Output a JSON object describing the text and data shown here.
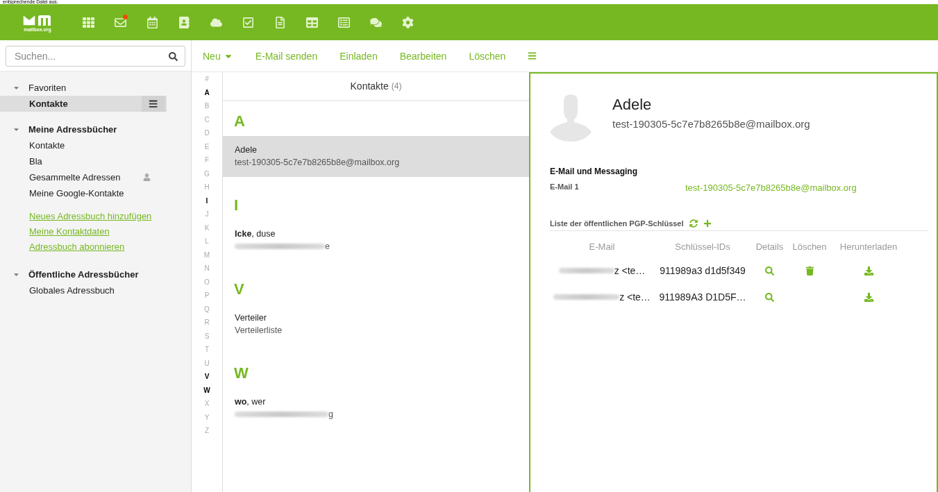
{
  "caption": "entsprechende Datei aus.",
  "app_bar": {
    "logo_text": "mailbox.org",
    "apps": [
      {
        "kind": "grid",
        "badge": false
      },
      {
        "kind": "mail",
        "badge": true
      },
      {
        "kind": "calendar",
        "badge": false
      },
      {
        "kind": "contacts",
        "badge": false
      },
      {
        "kind": "cloud",
        "badge": false
      },
      {
        "kind": "tasks",
        "badge": false
      },
      {
        "kind": "document",
        "badge": false
      },
      {
        "kind": "spreadsheet",
        "badge": false
      },
      {
        "kind": "presentation",
        "badge": false
      },
      {
        "kind": "chat",
        "badge": false
      },
      {
        "kind": "settings",
        "badge": false
      }
    ]
  },
  "search": {
    "placeholder": "Suchen..."
  },
  "toolbar": [
    {
      "label": "Neu",
      "dropdown": true
    },
    {
      "label": "E-Mail senden",
      "dropdown": false
    },
    {
      "label": "Einladen",
      "dropdown": false
    },
    {
      "label": "Bearbeiten",
      "dropdown": false
    },
    {
      "label": "Löschen",
      "dropdown": false
    }
  ],
  "sidebar": {
    "sections": [
      {
        "title": "Favoriten",
        "bold": false,
        "expanded": true,
        "items": [
          {
            "label": "Kontakte",
            "selected": true,
            "shared": false
          }
        ]
      },
      {
        "title": "Meine Adressbücher",
        "bold": true,
        "expanded": true,
        "items": [
          {
            "label": "Kontakte",
            "selected": false,
            "shared": false
          },
          {
            "label": "Bla",
            "selected": false,
            "shared": false
          },
          {
            "label": "Gesammelte Adressen",
            "selected": false,
            "shared": true
          },
          {
            "label": "Meine Google-Kontakte",
            "selected": false,
            "shared": false
          }
        ],
        "links": [
          "Neues Adressbuch hinzufügen",
          "Meine Kontaktdaten",
          "Adressbuch abonnieren"
        ]
      },
      {
        "title": "Öffentliche Adressbücher",
        "bold": true,
        "expanded": true,
        "items": [
          {
            "label": "Globales Adressbuch",
            "selected": false,
            "shared": false
          }
        ]
      }
    ]
  },
  "alphabet": [
    {
      "letter": "#",
      "has_entries": false
    },
    {
      "letter": "A",
      "has_entries": true
    },
    {
      "letter": "B",
      "has_entries": false
    },
    {
      "letter": "C",
      "has_entries": false
    },
    {
      "letter": "D",
      "has_entries": false
    },
    {
      "letter": "E",
      "has_entries": false
    },
    {
      "letter": "F",
      "has_entries": false
    },
    {
      "letter": "G",
      "has_entries": false
    },
    {
      "letter": "H",
      "has_entries": false
    },
    {
      "letter": "I",
      "has_entries": true
    },
    {
      "letter": "J",
      "has_entries": false
    },
    {
      "letter": "K",
      "has_entries": false
    },
    {
      "letter": "L",
      "has_entries": false
    },
    {
      "letter": "M",
      "has_entries": false
    },
    {
      "letter": "N",
      "has_entries": false
    },
    {
      "letter": "O",
      "has_entries": false
    },
    {
      "letter": "P",
      "has_entries": false
    },
    {
      "letter": "Q",
      "has_entries": false
    },
    {
      "letter": "R",
      "has_entries": false
    },
    {
      "letter": "S",
      "has_entries": false
    },
    {
      "letter": "T",
      "has_entries": false
    },
    {
      "letter": "U",
      "has_entries": false
    },
    {
      "letter": "V",
      "has_entries": true
    },
    {
      "letter": "W",
      "has_entries": true
    },
    {
      "letter": "X",
      "has_entries": false
    },
    {
      "letter": "Y",
      "has_entries": false
    },
    {
      "letter": "Z",
      "has_entries": false
    }
  ],
  "contact_list": {
    "title": "Kontakte",
    "count": "(4)",
    "groups": [
      {
        "letter": "A",
        "contacts": [
          {
            "name": "Adele",
            "detail": "test-190305-5c7e7b8265b8e@mailbox.org",
            "selected": true,
            "blurred": false
          }
        ]
      },
      {
        "letter": "I",
        "contacts": [
          {
            "name": "**Icke**, duse",
            "detail": "e",
            "selected": false,
            "blurred": true
          }
        ]
      },
      {
        "letter": "V",
        "contacts": [
          {
            "name": "Verteiler",
            "detail": "Verteilerliste",
            "selected": false,
            "blurred": false
          }
        ]
      },
      {
        "letter": "W",
        "contacts": [
          {
            "name": "**wo**, wer",
            "detail": "g",
            "selected": false,
            "blurred": true
          }
        ]
      }
    ]
  },
  "detail": {
    "name": "Adele",
    "email": "test-190305-5c7e7b8265b8e@mailbox.org",
    "section_title": "E-Mail und Messaging",
    "fields": [
      {
        "label": "E-Mail 1",
        "value": "test-190305-5c7e7b8265b8e@mailbox.org"
      }
    ],
    "pgp": {
      "title": "Liste der öffentlichen PGP-Schlüssel",
      "columns": [
        "E-Mail",
        "Schlüssel-IDs",
        "Details",
        "Löschen",
        "Herunterladen"
      ],
      "rows": [
        {
          "email": "z <te…",
          "key_ids": "911989a3 d1d5f349",
          "deletable": true
        },
        {
          "email": "z <te…",
          "key_ids": "911989A3 D1D5F…",
          "deletable": false
        }
      ]
    }
  }
}
